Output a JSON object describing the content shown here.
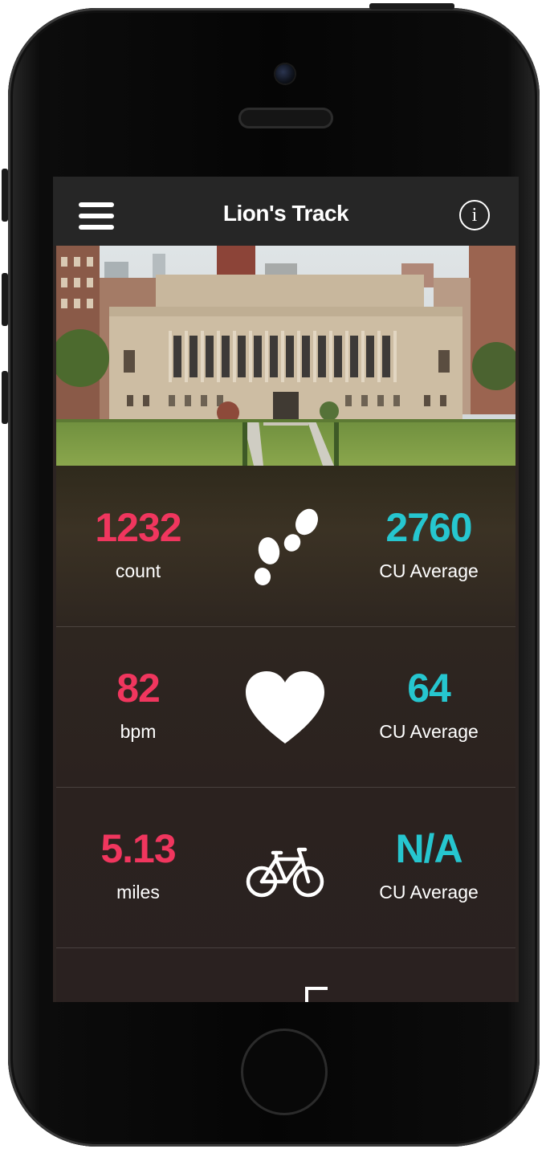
{
  "header": {
    "title": "Lion's Track",
    "menu_icon": "hamburger-menu-icon",
    "info_icon": "info-icon",
    "info_glyph": "i"
  },
  "hero": {
    "image": "campus-library-photo"
  },
  "stats": [
    {
      "value": "1232",
      "label": "count",
      "icon": "footsteps-icon",
      "average": "2760",
      "average_label": "CU Average"
    },
    {
      "value": "82",
      "label": "bpm",
      "icon": "heart-icon",
      "average": "64",
      "average_label": "CU Average"
    },
    {
      "value": "5.13",
      "label": "miles",
      "icon": "bicycle-icon",
      "average": "N/A",
      "average_label": "CU Average"
    }
  ],
  "colors": {
    "value": "#f0365e",
    "average": "#26c6cf",
    "navbar": "#262626"
  }
}
